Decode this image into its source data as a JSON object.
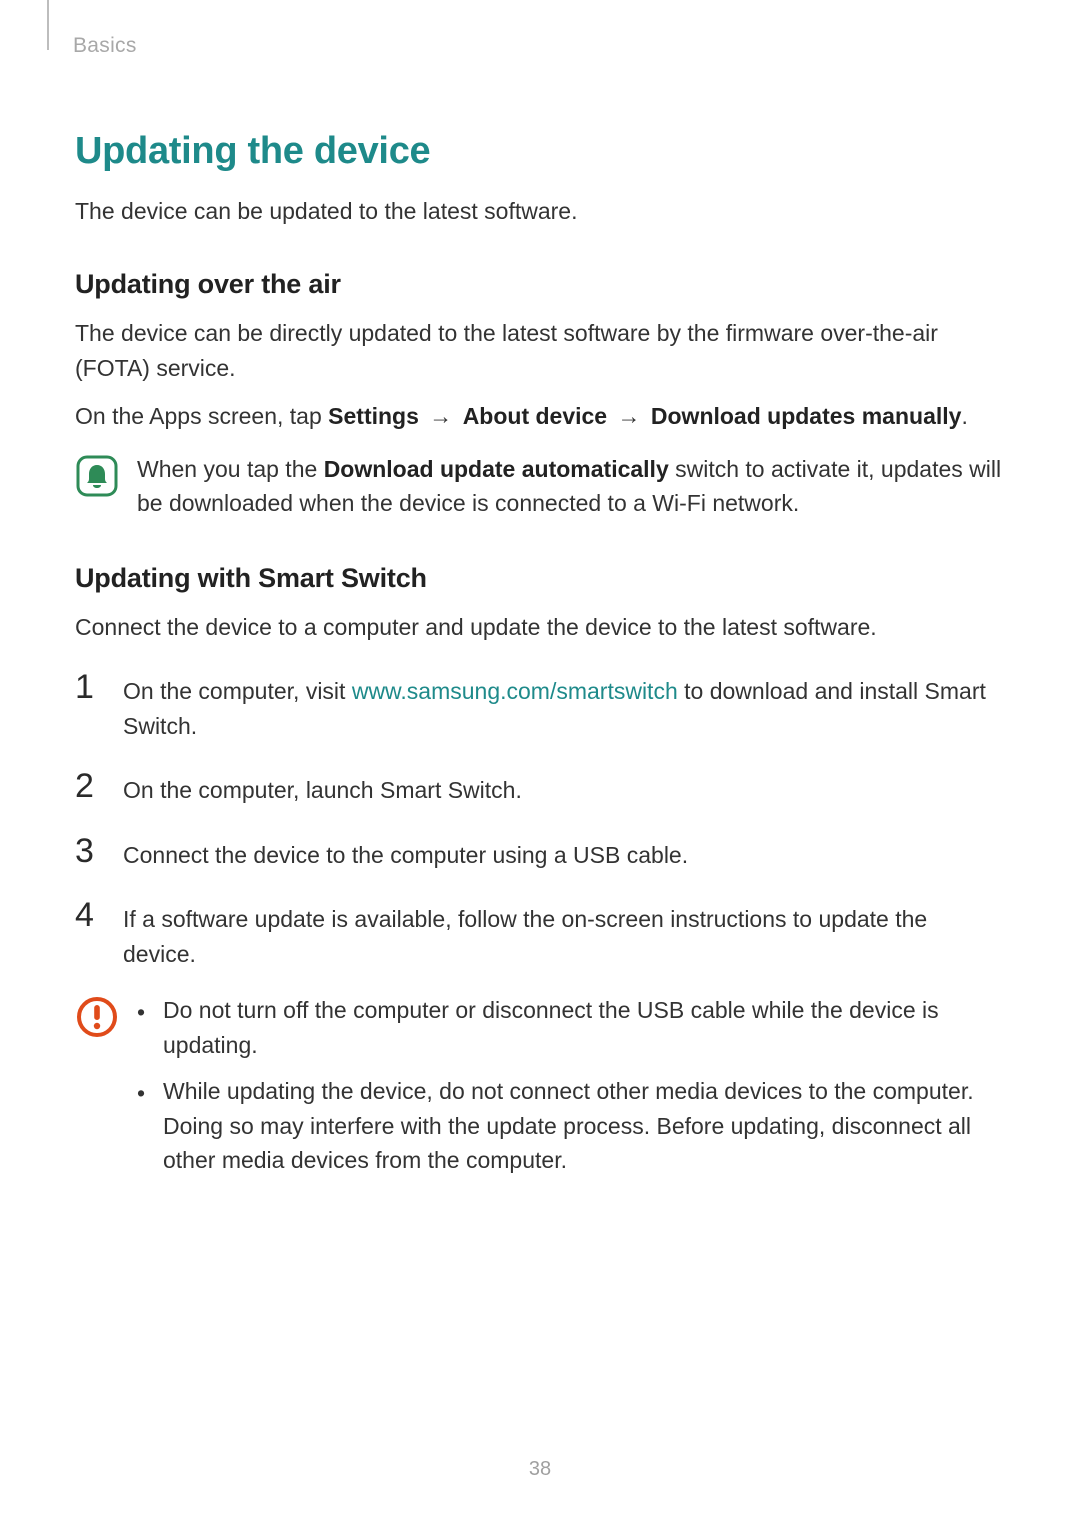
{
  "breadcrumb": "Basics",
  "h1": "Updating the device",
  "intro": "The device can be updated to the latest software.",
  "section1": {
    "title": "Updating over the air",
    "para": "The device can be directly updated to the latest software by the firmware over-the-air (FOTA) service.",
    "path_prefix": "On the Apps screen, tap ",
    "path_parts": [
      "Settings",
      "About device",
      "Download updates manually"
    ],
    "note_before": "When you tap the ",
    "note_bold": "Download update automatically",
    "note_after": " switch to activate it, updates will be downloaded when the device is connected to a Wi-Fi network."
  },
  "section2": {
    "title": "Updating with Smart Switch",
    "para": "Connect the device to a computer and update the device to the latest software.",
    "steps": {
      "s1_before": "On the computer, visit ",
      "s1_link": "www.samsung.com/smartswitch",
      "s1_after": " to download and install Smart Switch.",
      "s2": "On the computer, launch Smart Switch.",
      "s3": "Connect the device to the computer using a USB cable.",
      "s4": "If a software update is available, follow the on-screen instructions to update the device."
    },
    "caution": {
      "b1": "Do not turn off the computer or disconnect the USB cable while the device is updating.",
      "b2": "While updating the device, do not connect other media devices to the computer. Doing so may interfere with the update process. Before updating, disconnect all other media devices from the computer."
    }
  },
  "step_nums": [
    "1",
    "2",
    "3",
    "4"
  ],
  "page_number": "38",
  "bullet_char": "•",
  "arrow_char": "→"
}
